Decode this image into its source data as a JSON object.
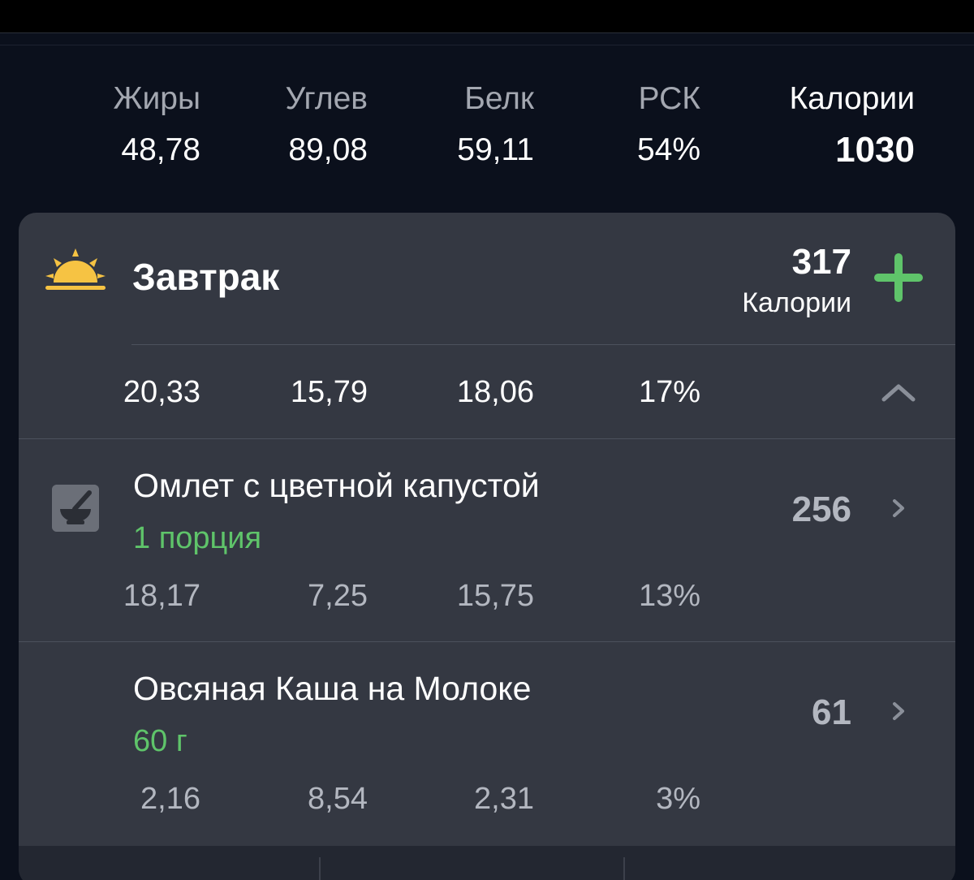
{
  "summary": {
    "fat": {
      "label": "Жиры",
      "value": "48,78"
    },
    "carbs": {
      "label": "Углев",
      "value": "89,08"
    },
    "protein": {
      "label": "Белк",
      "value": "59,11"
    },
    "rdi": {
      "label": "РСК",
      "value": "54%"
    },
    "calories": {
      "label": "Калории",
      "value": "1030"
    }
  },
  "meal": {
    "title": "Завтрак",
    "icon": "sunrise-icon",
    "calories_value": "317",
    "calories_label": "Калории",
    "add_icon": "plus-icon",
    "totals": {
      "fat": "20,33",
      "carbs": "15,79",
      "protein": "18,06",
      "rdi": "17%"
    },
    "collapse_icon": "chevron-up-icon",
    "items": [
      {
        "name": "Омлет с цветной капустой",
        "portion": "1 порция",
        "calories": "256",
        "icon": "recipe-mortar-icon",
        "fat": "18,17",
        "carbs": "7,25",
        "protein": "15,75",
        "rdi": "13%"
      },
      {
        "name": "Овсяная Каша на Молоке",
        "portion": "60 г",
        "calories": "61",
        "fat": "2,16",
        "carbs": "8,54",
        "protein": "2,31",
        "rdi": "3%"
      }
    ]
  },
  "colors": {
    "background": "#0b101c",
    "card": "#343842",
    "accent_green": "#5fc46a",
    "sun_yellow": "#f6c343"
  }
}
